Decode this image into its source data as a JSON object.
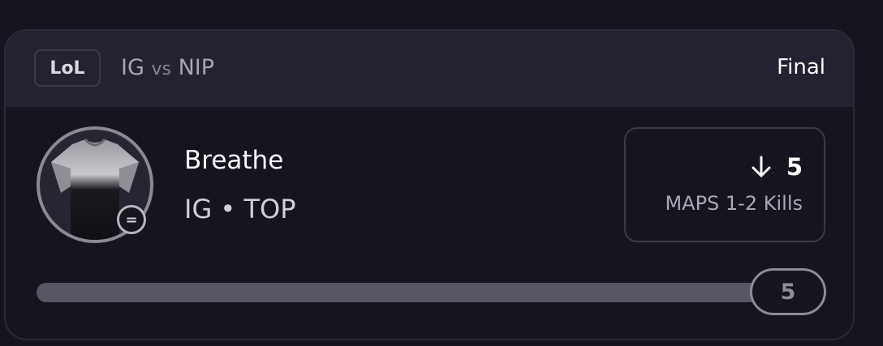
{
  "match": {
    "league": "LoL",
    "team_a": "IG",
    "vs": "vs",
    "team_b": "NIP",
    "status": "Final"
  },
  "player": {
    "name": "Breathe",
    "meta": "IG • TOP",
    "avatar_icon": "jersey-icon",
    "badge_icon": "equals-icon"
  },
  "stat": {
    "direction_icon": "arrow-down-icon",
    "value": "5",
    "label": "MAPS 1-2 Kills"
  },
  "progress": {
    "current": "5",
    "fraction": 1.0
  },
  "colors": {
    "background": "#151520",
    "header": "#222231",
    "accent_text": "#ffffff",
    "muted_text": "#a6a6b4"
  }
}
